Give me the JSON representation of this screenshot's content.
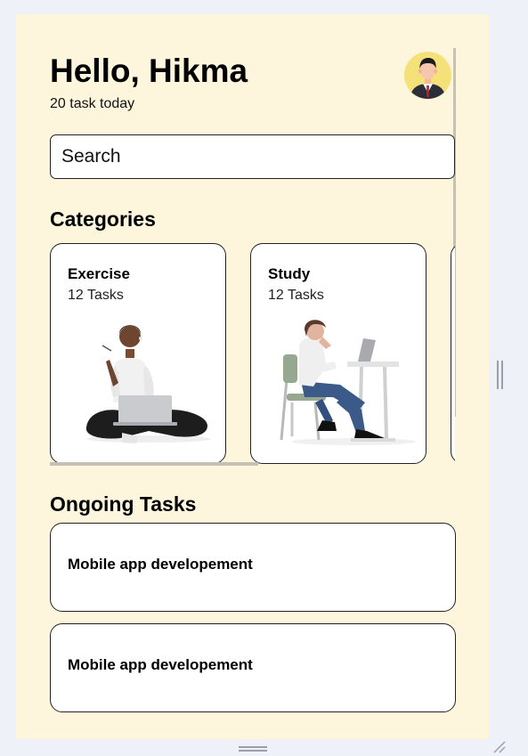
{
  "header": {
    "greeting": "Hello, Hikma",
    "subtitle": "20 task today"
  },
  "search": {
    "placeholder": "Search"
  },
  "categories": {
    "heading": "Categories",
    "items": [
      {
        "title": "Exercise",
        "count": "12 Tasks"
      },
      {
        "title": "Study",
        "count": "12 Tasks"
      }
    ]
  },
  "ongoing": {
    "heading": "Ongoing Tasks",
    "items": [
      {
        "title": "Mobile app developement"
      },
      {
        "title": "Mobile app developement"
      }
    ]
  },
  "colors": {
    "app_background": "#fef6dc",
    "page_background": "#eef1f8",
    "card_background": "#ffffff",
    "avatar_background": "#f5e17a"
  }
}
